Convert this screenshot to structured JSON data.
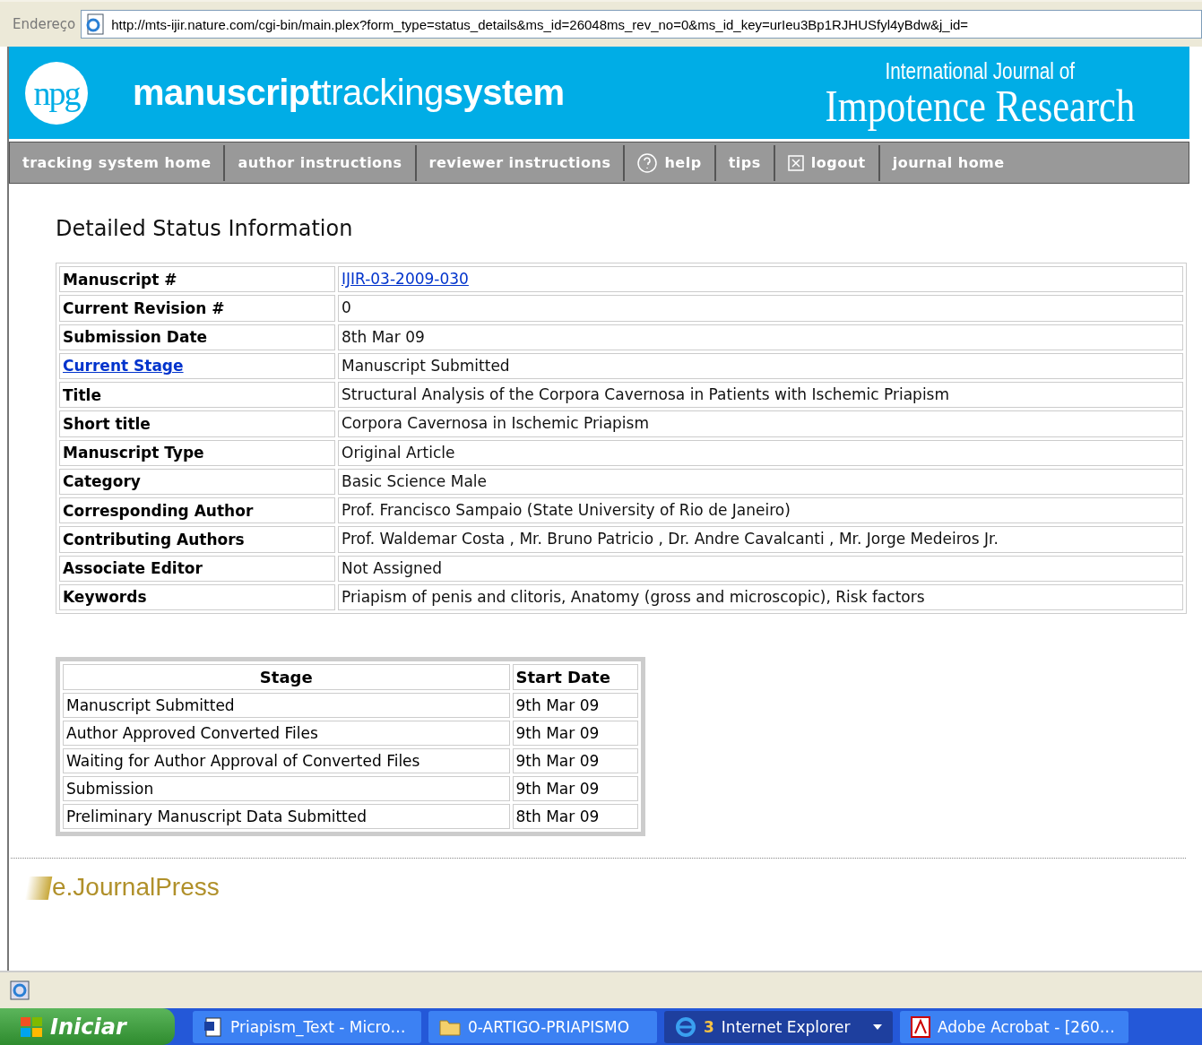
{
  "address_bar": {
    "label": "Endereço",
    "url": "http://mts-ijir.nature.com/cgi-bin/main.plex?form_type=status_details&ms_id=26048ms_rev_no=0&ms_id_key=urIeu3Bp1RJHUSfyl4yBdw&j_id="
  },
  "header": {
    "logo": "npg",
    "title_parts": [
      "manuscript",
      "tracking",
      "system"
    ],
    "journal_small": "International Journal of",
    "journal_big": "Impotence Research"
  },
  "nav": [
    {
      "label": "tracking system home",
      "kind": "link"
    },
    {
      "label": "author instructions",
      "kind": "link"
    },
    {
      "label": "reviewer instructions",
      "kind": "link"
    },
    {
      "label": "help",
      "kind": "help"
    },
    {
      "label": "tips",
      "kind": "link"
    },
    {
      "label": "logout",
      "kind": "logout"
    },
    {
      "label": "journal home",
      "kind": "link"
    }
  ],
  "heading": "Detailed Status Information",
  "details": [
    {
      "label": "Manuscript #",
      "value": "IJIR-03-2009-030",
      "label_link": false,
      "value_link": true
    },
    {
      "label": "Current Revision #",
      "value": "0",
      "label_link": false,
      "value_link": false
    },
    {
      "label": "Submission Date",
      "value": "8th Mar 09",
      "label_link": false,
      "value_link": false
    },
    {
      "label": "Current Stage",
      "value": "Manuscript Submitted",
      "label_link": true,
      "value_link": false
    },
    {
      "label": "Title",
      "value": "Structural Analysis of the Corpora Cavernosa in Patients with Ischemic Priapism",
      "label_link": false,
      "value_link": false
    },
    {
      "label": "Short title",
      "value": "Corpora Cavernosa in Ischemic Priapism",
      "label_link": false,
      "value_link": false
    },
    {
      "label": "Manuscript Type",
      "value": "Original Article",
      "label_link": false,
      "value_link": false
    },
    {
      "label": "Category",
      "value": "Basic Science Male",
      "label_link": false,
      "value_link": false
    },
    {
      "label": "Corresponding Author",
      "value": "Prof. Francisco Sampaio (State University of Rio de Janeiro)",
      "label_link": false,
      "value_link": false
    },
    {
      "label": "Contributing Authors",
      "value": "Prof. Waldemar Costa , Mr. Bruno Patricio , Dr. Andre Cavalcanti , Mr. Jorge Medeiros Jr.",
      "label_link": false,
      "value_link": false
    },
    {
      "label": "Associate Editor",
      "value": "Not Assigned",
      "label_link": false,
      "value_link": false
    },
    {
      "label": "Keywords",
      "value": "Priapism of penis and clitoris, Anatomy (gross and microscopic), Risk factors",
      "label_link": false,
      "value_link": false
    }
  ],
  "stages": {
    "columns": [
      "Stage",
      "Start Date"
    ],
    "rows": [
      [
        "Manuscript Submitted",
        "9th Mar 09"
      ],
      [
        "Author Approved Converted Files",
        "9th Mar 09"
      ],
      [
        "Waiting for Author Approval of Converted Files",
        "9th Mar 09"
      ],
      [
        "Submission",
        "9th Mar 09"
      ],
      [
        "Preliminary Manuscript Data Submitted",
        "8th Mar 09"
      ]
    ]
  },
  "footer_logo": "e.JournalPress",
  "taskbar": {
    "start": "Iniciar",
    "items": [
      {
        "label": "Priapism_Text - Micro…",
        "kind": "document",
        "selected": false
      },
      {
        "label": "0-ARTIGO-PRIAPISMO",
        "kind": "folder",
        "selected": false
      },
      {
        "label": "Internet Explorer",
        "kind": "browser",
        "count": "3",
        "selected": true
      },
      {
        "label": "Adobe Acrobat - [260…",
        "kind": "pdf",
        "selected": false
      }
    ]
  }
}
